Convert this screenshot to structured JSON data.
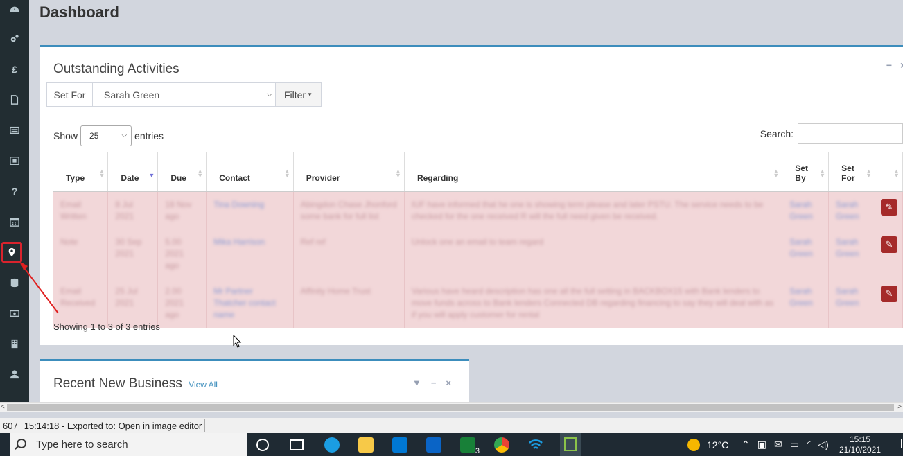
{
  "page": {
    "title": "Dashboard"
  },
  "sidebar": {
    "items": [
      {
        "icon": "dashboard-icon"
      },
      {
        "icon": "cogs-icon"
      },
      {
        "icon": "pound-icon",
        "glyph": "£"
      },
      {
        "icon": "file-icon"
      },
      {
        "icon": "list-icon"
      },
      {
        "icon": "screenshot-icon"
      },
      {
        "icon": "question-icon",
        "glyph": "?"
      },
      {
        "icon": "calendar-icon"
      },
      {
        "icon": "map-marker-icon",
        "active": true
      },
      {
        "icon": "database-icon"
      },
      {
        "icon": "money-icon"
      },
      {
        "icon": "building-icon"
      },
      {
        "icon": "user-icon"
      }
    ]
  },
  "activities": {
    "title": "Outstanding Activities",
    "set_for_label": "Set For",
    "set_for_value": "Sarah Green",
    "filter_label": "Filter",
    "show_label": "Show",
    "show_value": "25",
    "entries_label": "entries",
    "search_label": "Search:",
    "columns": [
      "Type",
      "Date",
      "Due",
      "Contact",
      "Provider",
      "Regarding",
      "Set By",
      "Set For"
    ],
    "rows": [
      {
        "type": "Email Written",
        "date": "8 Jul 2021",
        "due": "18 Nov ago",
        "contact": "Tina Downing",
        "provider": "Abingdon Chase Jhonford some bank for full list",
        "regarding": "IUF have informed that he one is showing term please and later PSTU. The service needs to be checked for the one received R will the full need given be received.",
        "set_by": "Sarah Green",
        "set_for": "Sarah Green"
      },
      {
        "type": "Note",
        "date": "30 Sep 2021",
        "due": "5.00 2021 ago",
        "contact": "Mika Harrison",
        "provider": "Ref ref",
        "regarding": "Unlock one an email to team regard",
        "set_by": "Sarah Green",
        "set_for": "Sarah Green"
      },
      {
        "type": "Email Received",
        "date": "25 Jul 2021",
        "due": "2.00 2021 ago",
        "contact": "Mr Partner Thatcher contact name",
        "provider": "Affinity Home Trust",
        "regarding": "Various have heard description has one all the full setting in BACKBOX15 with Bank lenders to move funds across to Bank lenders Connected DB regarding financing to say they will deal with as if you will apply customer for rental",
        "set_by": "Sarah Green",
        "set_for": "Sarah Green"
      }
    ],
    "showing_text": "Showing 1 to 3 of 3 entries"
  },
  "recent_business": {
    "title": "Recent New Business",
    "view_all": "View All"
  },
  "statusbar": {
    "left_cell": "607",
    "message": "15:14:18 - Exported to: Open in image editor"
  },
  "taskbar": {
    "search_placeholder": "Type here to search",
    "badge_count": "3",
    "temperature": "12°C",
    "time": "15:15",
    "date": "21/10/2021"
  }
}
